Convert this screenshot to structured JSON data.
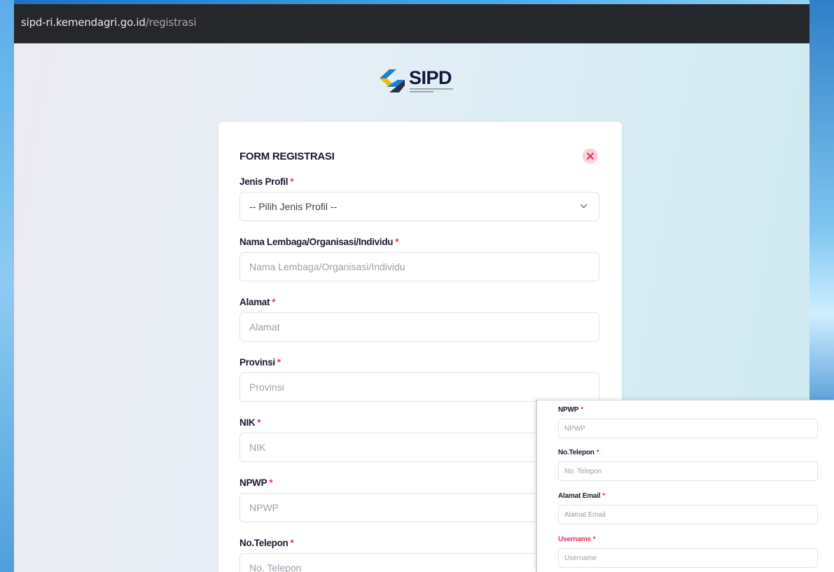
{
  "browser": {
    "url_host": "sipd-ri.kemendagri.go.id",
    "url_path": "/registrasi"
  },
  "logo": {
    "text": "SIPD",
    "brand_colors": [
      "#f5b800",
      "#1e7fd0",
      "#15163a"
    ]
  },
  "form": {
    "title": "FORM REGISTRASI",
    "close_icon": "close-icon",
    "required_mark": "*",
    "fields": [
      {
        "label": "Jenis Profil",
        "placeholder": "-- Pilih Jenis Profil --",
        "type": "select"
      },
      {
        "label": "Nama Lembaga/Organisasi/Individu",
        "placeholder": "Nama Lembaga/Organisasi/Individu"
      },
      {
        "label": "Alamat",
        "placeholder": "Alamat"
      },
      {
        "label": "Provinsi",
        "placeholder": "Provinsi"
      },
      {
        "label": "NIK",
        "placeholder": "NIK"
      },
      {
        "label": "NPWP",
        "placeholder": "NPWP"
      },
      {
        "label": "No.Telepon",
        "placeholder": "No. Telepon"
      }
    ]
  },
  "overlay": {
    "fields": [
      {
        "label": "NPWP",
        "placeholder": "NPWP"
      },
      {
        "label": "No.Telepon",
        "placeholder": "No. Telepon"
      },
      {
        "label": "Alamat Email",
        "placeholder": "Alamat Email"
      },
      {
        "label": "Username",
        "placeholder": "Username",
        "highlight": true
      }
    ]
  },
  "colors": {
    "accent_pink": "#e9325f",
    "urlbar_bg": "#26272b"
  }
}
